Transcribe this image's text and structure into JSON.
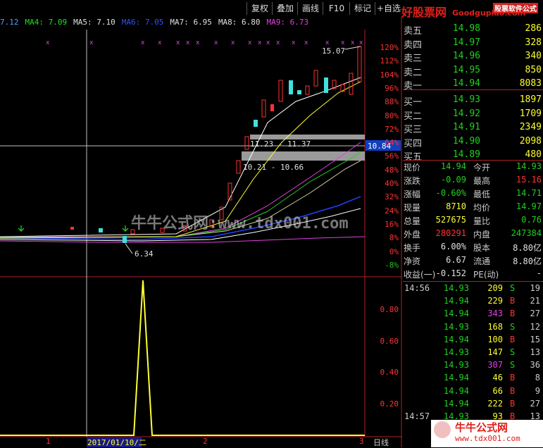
{
  "toolbar": {
    "buttons": [
      "复权",
      "叠加",
      "画线",
      "F10",
      "标记",
      "+自选"
    ],
    "logo_main": "好股票网",
    "logo_sub": "Goodgupiao.com",
    "logo_tag": "股票软件公式"
  },
  "ma_bar": [
    {
      "label": "7.12",
      "color": "#4fa0ff"
    },
    {
      "label": "MA4: 7.09",
      "color": "#20e020"
    },
    {
      "label": "MA5: 7.10",
      "color": "#e0e0e0"
    },
    {
      "label": "MA6: 7.05",
      "color": "#3050ff"
    },
    {
      "label": "MA7: 6.95",
      "color": "#e0e0e0"
    },
    {
      "label": "MA8: 6.80",
      "color": "#e0e0e0"
    },
    {
      "label": "MA9: 6.73",
      "color": "#e040e0"
    }
  ],
  "price_axis": [
    "120%",
    "112%",
    "104%",
    "96%",
    "88%",
    "80%",
    "72%",
    "64%",
    "56%",
    "48%",
    "40%",
    "32%",
    "24%",
    "16%",
    "8%",
    "0%",
    "-8%"
  ],
  "price_tag": "10.84",
  "annotations": {
    "high": "15.07",
    "low": "6.34",
    "range1": "11.23 - 11.37",
    "range2": "10.21 - 10.66"
  },
  "watermark": "牛牛公式网:www.tdx001.com",
  "indicator_axis": [
    "0.80",
    "0.60",
    "0.40",
    "0.20"
  ],
  "x_axis": {
    "label1": "1",
    "date": "2017/01/10/二",
    "label2": "2",
    "label3": "3",
    "tab": "日线"
  },
  "order_book": [
    {
      "label": "卖五",
      "price": "14.98",
      "qty": "286"
    },
    {
      "label": "卖四",
      "price": "14.97",
      "qty": "328"
    },
    {
      "label": "卖三",
      "price": "14.96",
      "qty": "340"
    },
    {
      "label": "卖二",
      "price": "14.95",
      "qty": "850"
    },
    {
      "label": "卖一",
      "price": "14.94",
      "qty": "8083"
    },
    {
      "label": "买一",
      "price": "14.93",
      "qty": "1897"
    },
    {
      "label": "买二",
      "price": "14.92",
      "qty": "1709"
    },
    {
      "label": "买三",
      "price": "14.91",
      "qty": "2349"
    },
    {
      "label": "买四",
      "price": "14.90",
      "qty": "2098"
    },
    {
      "label": "买五",
      "price": "14.89",
      "qty": "480"
    }
  ],
  "quote": [
    {
      "l": "现价",
      "v": "14.94",
      "vc": "#20d020",
      "l2": "今开",
      "v2": "14.93",
      "v2c": "#20d020"
    },
    {
      "l": "涨跌",
      "v": "-0.09",
      "vc": "#20d020",
      "l2": "最高",
      "v2": "15.16",
      "v2c": "#ff3232"
    },
    {
      "l": "涨幅",
      "v": "-0.60%",
      "vc": "#20d020",
      "l2": "最低",
      "v2": "14.71",
      "v2c": "#20d020"
    },
    {
      "l": "现量",
      "v": "8710",
      "vc": "#ffff30",
      "l2": "均价",
      "v2": "14.97",
      "v2c": "#20d020"
    },
    {
      "l": "总量",
      "v": "527675",
      "vc": "#ffff30",
      "l2": "量比",
      "v2": "0.76",
      "v2c": "#20d020"
    },
    {
      "l": "外盘",
      "v": "280291",
      "vc": "#ff3232",
      "l2": "内盘",
      "v2": "247384",
      "v2c": "#20d020"
    },
    {
      "l": "换手",
      "v": "6.00%",
      "vc": "#e0e0e0",
      "l2": "股本",
      "v2": "8.80亿",
      "v2c": "#e0e0e0"
    },
    {
      "l": "净资",
      "v": "6.67",
      "vc": "#e0e0e0",
      "l2": "流通",
      "v2": "8.80亿",
      "v2c": "#e0e0e0"
    },
    {
      "l": "收益(一)",
      "v": "-0.152",
      "vc": "#e0e0e0",
      "l2": "PE(动)",
      "v2": "-",
      "v2c": "#e0e0e0"
    }
  ],
  "ticks": [
    {
      "t": "14:56",
      "p": "14.93",
      "n": "209",
      "s": "S",
      "k": "19"
    },
    {
      "t": "",
      "p": "14.94",
      "n": "229",
      "s": "B",
      "k": "21"
    },
    {
      "t": "",
      "p": "14.94",
      "n": "343",
      "s": "B",
      "k": "27"
    },
    {
      "t": "",
      "p": "14.93",
      "n": "168",
      "s": "S",
      "k": "12"
    },
    {
      "t": "",
      "p": "14.94",
      "n": "100",
      "s": "B",
      "k": "15"
    },
    {
      "t": "",
      "p": "14.93",
      "n": "147",
      "s": "S",
      "k": "13"
    },
    {
      "t": "",
      "p": "14.93",
      "n": "307",
      "s": "S",
      "k": "36"
    },
    {
      "t": "",
      "p": "14.94",
      "n": "46",
      "s": "B",
      "k": "8"
    },
    {
      "t": "",
      "p": "14.94",
      "n": "66",
      "s": "B",
      "k": "9"
    },
    {
      "t": "",
      "p": "14.94",
      "n": "222",
      "s": "B",
      "k": "27"
    },
    {
      "t": "14:57",
      "p": "14.93",
      "n": "93",
      "s": "B",
      "k": "13"
    }
  ],
  "footer_logo": "牛牛公式网",
  "footer_url": "www.tdx001.com"
}
